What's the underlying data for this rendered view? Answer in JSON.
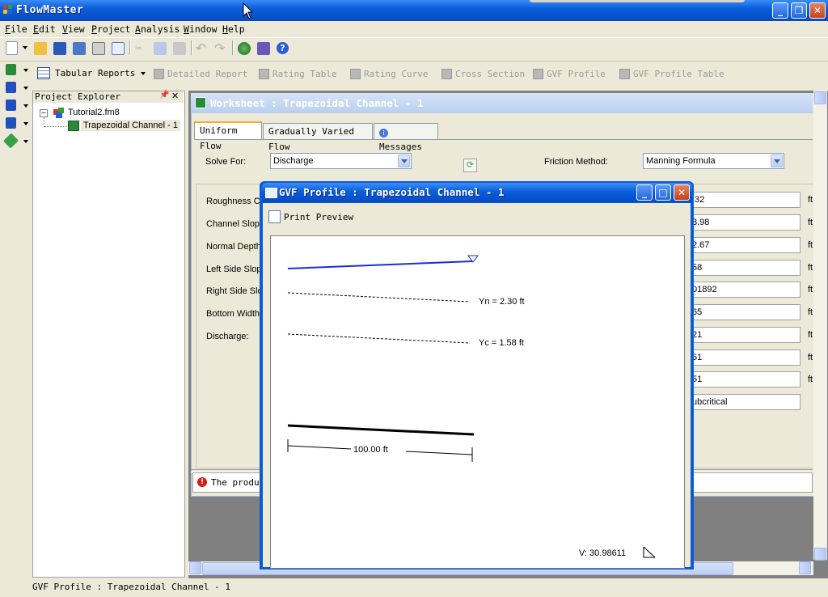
{
  "app": {
    "title": "FlowMaster"
  },
  "menu": [
    {
      "label": "File",
      "u": "F",
      "rest": "ile"
    },
    {
      "label": "Edit",
      "u": "E",
      "rest": "dit"
    },
    {
      "label": "View",
      "u": "V",
      "rest": "iew"
    },
    {
      "label": "Project",
      "u": "P",
      "rest": "roject"
    },
    {
      "label": "Analysis",
      "u": "A",
      "rest": "nalysis"
    },
    {
      "label": "Window",
      "u": "W",
      "rest": "indow"
    },
    {
      "label": "Help",
      "u": "H",
      "rest": "elp"
    }
  ],
  "reports_toolbar": {
    "tabular_reports": "Tabular Reports",
    "detailed_report": "Detailed Report",
    "rating_table": "Rating Table",
    "rating_curve": "Rating Curve",
    "cross_section": "Cross Section",
    "gvf_profile": "GVF Profile",
    "gvf_profile_table": "GVF Profile Table"
  },
  "project_explorer": {
    "title": "Project Explorer",
    "file": "Tutorial2.fm8",
    "item": "Trapezoidal Channel - 1"
  },
  "worksheet": {
    "title": "Worksheet : Trapezoidal Channel - 1",
    "tabs": [
      "Uniform Flow",
      "Gradually Varied Flow",
      "Messages"
    ],
    "solve_for_label": "Solve For:",
    "solve_for_value": "Discharge",
    "friction_label": "Friction Method:",
    "friction_value": "Manning Formula",
    "inputs": [
      "Roughness C",
      "Channel Slope",
      "Normal Depth",
      "Left Side Slop",
      "Right Side Slo",
      "Bottom Width:",
      "Discharge:"
    ],
    "results": [
      ".32",
      "3.98",
      "2.67",
      "58",
      "01892",
      "65",
      "21",
      "51",
      "51",
      "ubcritical"
    ],
    "units": [
      "ft",
      "ft",
      "ft",
      "ft",
      "ft",
      "ft",
      "ft",
      "ft",
      "ft"
    ],
    "message": "The produc"
  },
  "gvf_dialog": {
    "title": "GVF Profile : Trapezoidal Channel - 1",
    "print_preview": "Print Preview",
    "yn_label": "Yn = 2.30 ft",
    "yc_label": "Yc = 1.58 ft",
    "length_label": "100.00 ft",
    "velocity_label": "V: 30.98611"
  },
  "status": {
    "text": "GVF Profile : Trapezoidal Channel - 1"
  }
}
